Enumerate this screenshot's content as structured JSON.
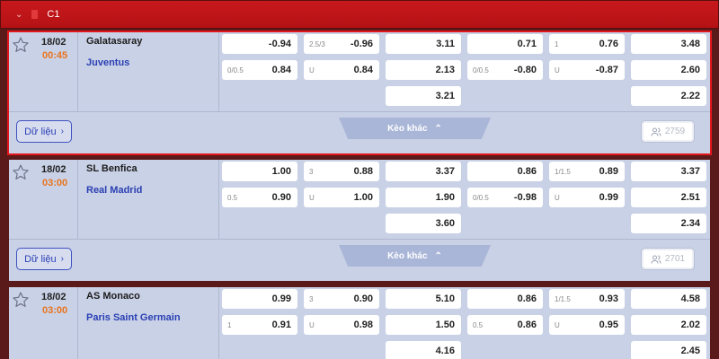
{
  "league": {
    "name": "C1"
  },
  "matches": [
    {
      "date": "18/02",
      "time": "00:45",
      "home": "Galatasaray",
      "away": "Juventus",
      "rows": [
        [
          {
            "l": "",
            "v": "-0.94"
          },
          {
            "l": "2.5/3",
            "v": "-0.96"
          },
          {
            "l": "",
            "v": "3.11"
          },
          {
            "l": "",
            "v": "0.71"
          },
          {
            "l": "1",
            "v": "0.76"
          },
          {
            "l": "",
            "v": "3.48"
          }
        ],
        [
          {
            "l": "0/0.5",
            "v": "0.84"
          },
          {
            "l": "U",
            "v": "0.84"
          },
          {
            "l": "",
            "v": "2.13"
          },
          {
            "l": "0/0.5",
            "v": "-0.80"
          },
          {
            "l": "U",
            "v": "-0.87"
          },
          {
            "l": "",
            "v": "2.60"
          }
        ],
        [
          {
            "l": "",
            "v": "3.21"
          },
          {
            "l": "",
            "v": "2.22"
          }
        ]
      ],
      "data_label": "Dữ liệu",
      "more_label": "Kèo khác",
      "count": "2759"
    },
    {
      "date": "18/02",
      "time": "03:00",
      "home": "SL Benfica",
      "away": "Real Madrid",
      "rows": [
        [
          {
            "l": "",
            "v": "1.00"
          },
          {
            "l": "3",
            "v": "0.88"
          },
          {
            "l": "",
            "v": "3.37"
          },
          {
            "l": "",
            "v": "0.86"
          },
          {
            "l": "1/1.5",
            "v": "0.89"
          },
          {
            "l": "",
            "v": "3.37"
          }
        ],
        [
          {
            "l": "0.5",
            "v": "0.90"
          },
          {
            "l": "U",
            "v": "1.00"
          },
          {
            "l": "",
            "v": "1.90"
          },
          {
            "l": "0/0.5",
            "v": "-0.98"
          },
          {
            "l": "U",
            "v": "0.99"
          },
          {
            "l": "",
            "v": "2.51"
          }
        ],
        [
          {
            "l": "",
            "v": "3.60"
          },
          {
            "l": "",
            "v": "2.34"
          }
        ]
      ],
      "data_label": "Dữ liệu",
      "more_label": "Kèo khác",
      "count": "2701"
    },
    {
      "date": "18/02",
      "time": "03:00",
      "home": "AS Monaco",
      "away": "Paris Saint Germain",
      "rows": [
        [
          {
            "l": "",
            "v": "0.99"
          },
          {
            "l": "3",
            "v": "0.90"
          },
          {
            "l": "",
            "v": "5.10"
          },
          {
            "l": "",
            "v": "0.86"
          },
          {
            "l": "1/1.5",
            "v": "0.93"
          },
          {
            "l": "",
            "v": "4.58"
          }
        ],
        [
          {
            "l": "1",
            "v": "0.91"
          },
          {
            "l": "U",
            "v": "0.98"
          },
          {
            "l": "",
            "v": "1.50"
          },
          {
            "l": "0.5",
            "v": "0.86"
          },
          {
            "l": "U",
            "v": "0.95"
          },
          {
            "l": "",
            "v": "2.02"
          }
        ],
        [
          {
            "l": "",
            "v": "4.16"
          },
          {
            "l": "",
            "v": "2.45"
          }
        ]
      ]
    }
  ],
  "colors": {
    "header": "#c8181c",
    "row_bg": "#c9d1e6",
    "time": "#e8741e",
    "away_team": "#2a3fb3",
    "selected_border": "#e3161b"
  },
  "icons": [
    "chevron-down-icon",
    "league-flag-icon",
    "star-icon",
    "chevron-up-icon",
    "users-icon",
    "chevron-right-icon"
  ]
}
